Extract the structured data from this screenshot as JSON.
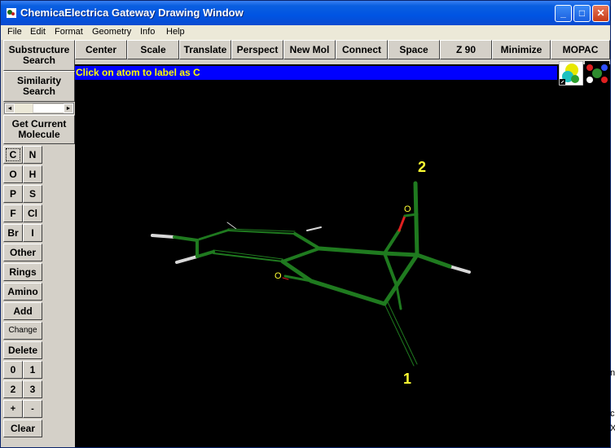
{
  "window": {
    "title": "ChemicaElectrica Gateway Drawing Window",
    "minimize_glyph": "_",
    "maximize_glyph": "□",
    "close_glyph": "✕"
  },
  "menu": [
    "File",
    "Edit",
    "Format",
    "Geometry",
    "Info",
    "Help"
  ],
  "toolbar": [
    "Center",
    "Scale",
    "Translate",
    "Perspect",
    "New Mol",
    "Connect",
    "Space",
    "Z 90",
    "Minimize",
    "MOPAC"
  ],
  "left_panel": {
    "substructure": [
      "Substructure",
      "Search"
    ],
    "similarity": [
      "Similarity",
      "Search"
    ],
    "scroll_left": "◄",
    "scroll_right": "►",
    "get_current": [
      "Get Current",
      "Molecule"
    ]
  },
  "elements": {
    "c": "C",
    "n": "N",
    "o": "O",
    "h": "H",
    "p": "P",
    "s": "S",
    "f": "F",
    "cl": "Cl",
    "br": "Br",
    "i": "I"
  },
  "side_buttons": {
    "other": "Other",
    "rings": "Rings",
    "amino": "Amino",
    "add": "Add",
    "change": "Change",
    "delete": "Delete",
    "n0": "0",
    "n1": "1",
    "n2": "2",
    "n3": "3",
    "plus": "+",
    "minus": "-",
    "clear": "Clear"
  },
  "status_message": "Click on atom to label as C",
  "molecule": {
    "label_1": "1",
    "label_2": "2",
    "oxygen_top": "O",
    "oxygen_left": "O",
    "bond_color": "#1f7a1f",
    "hydrogen_color": "#d8d8d8",
    "oxygen_bond_color": "#e02020"
  },
  "right_edge_glyphs": [
    "n",
    "c",
    "X"
  ]
}
